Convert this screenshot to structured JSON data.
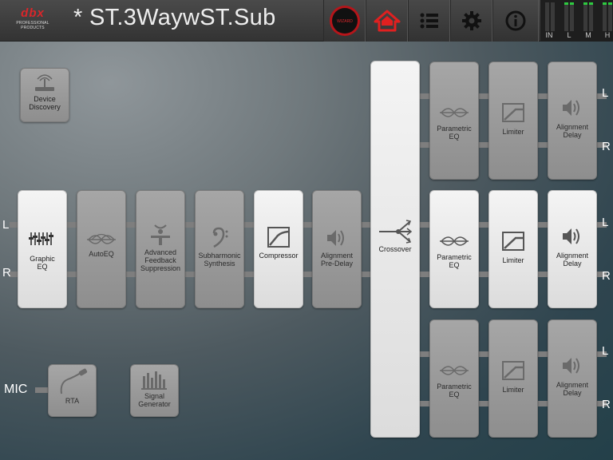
{
  "app": {
    "brand": "dbx",
    "brand_sub": "PROFESSIONAL PRODUCTS",
    "title": "* ST.3WaywST.Sub"
  },
  "toolbar": {
    "record_label": "WIZARD",
    "buttons": [
      "home-icon",
      "list-icon",
      "gear-icon",
      "info-icon"
    ]
  },
  "meters": {
    "labels": [
      "IN",
      "L",
      "M",
      "H"
    ]
  },
  "device_discovery": {
    "label": "Device\nDiscovery"
  },
  "input_chain": [
    {
      "label": "Graphic\nEQ",
      "on": true
    },
    {
      "label": "AutoEQ",
      "on": false
    },
    {
      "label": "Advanced\nFeedback\nSuppression",
      "on": false
    },
    {
      "label": "Subharmonic\nSynthesis",
      "on": false
    },
    {
      "label": "Compressor",
      "on": true
    },
    {
      "label": "Alignment\nPre-Delay",
      "on": false
    }
  ],
  "crossover": {
    "label": "Crossover"
  },
  "outputs": [
    {
      "peq": "Parametric\nEQ",
      "limiter": "Limiter",
      "delay": "Alignment\nDelay",
      "on": false
    },
    {
      "peq": "Parametric\nEQ",
      "limiter": "Limiter",
      "delay": "Alignment\nDelay",
      "on": true
    },
    {
      "peq": "Parametric\nEQ",
      "limiter": "Limiter",
      "delay": "Alignment\nDelay",
      "on": false
    }
  ],
  "channel_labels": {
    "left": "L",
    "right": "R",
    "mic": "MIC"
  },
  "bottom": {
    "rta": "RTA",
    "signal_gen": "Signal\nGenerator"
  },
  "colors": {
    "accent": "#d9262a",
    "meter_green": "#2ecc40",
    "block_on": "#e8e8e8",
    "block_off": "#9a9a9a"
  }
}
